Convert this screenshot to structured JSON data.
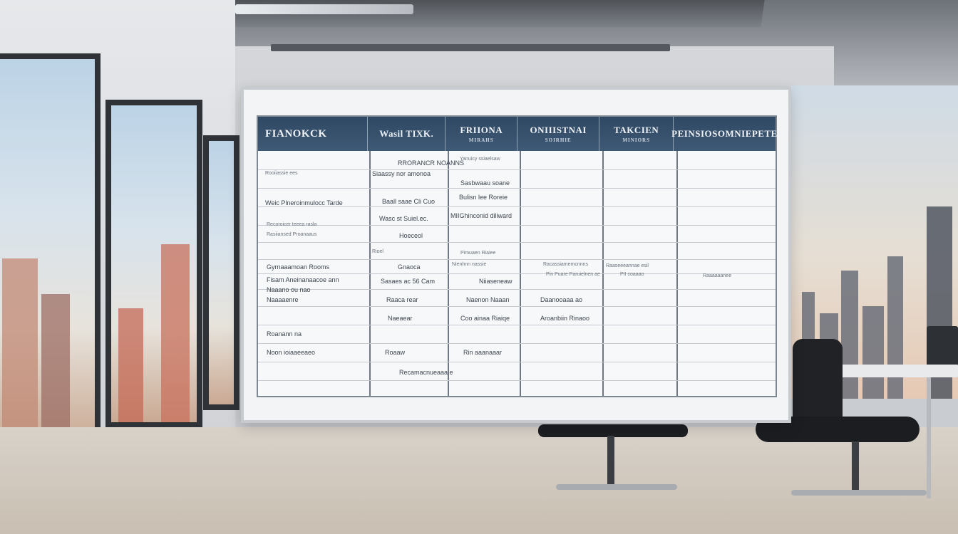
{
  "board": {
    "headers": [
      {
        "main": "FIANOKCK",
        "sub": ""
      },
      {
        "main": "Wasil TIXK.",
        "sub": ""
      },
      {
        "main": "FRIIONA",
        "sub": "MIRAHS"
      },
      {
        "main": "ONIIISTNAI",
        "sub": "SOIRHIE"
      },
      {
        "main": "TAKCIEN",
        "sub": "MINIORS"
      },
      {
        "main": "PEINSIOSOMNIEPETE",
        "sub": ""
      }
    ],
    "cells": [
      {
        "id": "c1",
        "text": "Rooiiassie ees"
      },
      {
        "id": "c2",
        "text": "RRORANCR NOANNS"
      },
      {
        "id": "c3",
        "text": "Siaassy nor amonoa"
      },
      {
        "id": "c4",
        "text": "Yanuicy ssiaelsaw"
      },
      {
        "id": "c5",
        "text": "Sasbwaau soane"
      },
      {
        "id": "c6",
        "text": "Weic Plneroinmulocc Tarde"
      },
      {
        "id": "c7",
        "text": "Baall saae Cli Cuo"
      },
      {
        "id": "c8",
        "text": "Bulisn lee Roreie"
      },
      {
        "id": "c9",
        "text": "Wasc st Suiel.ec."
      },
      {
        "id": "c10",
        "text": "MIIGhinconid diliward"
      },
      {
        "id": "c11",
        "text": "Recoroicer teeea rasla"
      },
      {
        "id": "c12",
        "text": "Hoeceol"
      },
      {
        "id": "c13",
        "text": "Rasiiansed Proanaaus"
      },
      {
        "id": "c14",
        "text": "Rioel"
      },
      {
        "id": "c15",
        "text": "Pimuaen Riaiee"
      },
      {
        "id": "c16",
        "text": "Gyrnaaamoan Rooms"
      },
      {
        "id": "c17",
        "text": "Gnaoca"
      },
      {
        "id": "c18",
        "text": "Nienhnn nassie"
      },
      {
        "id": "c19",
        "text": "Racassiamemcnnns"
      },
      {
        "id": "c20",
        "text": "Raaseeeannae esil"
      },
      {
        "id": "c21",
        "text": "Raaaaaanee"
      },
      {
        "id": "c22",
        "text": "Fisam Aneinanaacoe ann"
      },
      {
        "id": "c23",
        "text": "Sasaes ac 56 Cam"
      },
      {
        "id": "c24",
        "text": "Niiaseneaw"
      },
      {
        "id": "c25",
        "text": "Pin Puare Paruielnen ae"
      },
      {
        "id": "c26",
        "text": "PII coaaao"
      },
      {
        "id": "c27",
        "text": "Naaano ou nao"
      },
      {
        "id": "c28",
        "text": "Naaaaenre"
      },
      {
        "id": "c29",
        "text": "Raaca rear"
      },
      {
        "id": "c30",
        "text": "Naenon Naaan"
      },
      {
        "id": "c31",
        "text": "Daanooaaa ao"
      },
      {
        "id": "c32",
        "text": "Naeaear"
      },
      {
        "id": "c33",
        "text": "Coo ainaa Riaiqe"
      },
      {
        "id": "c34",
        "text": "Aroanbiin Rinaoo"
      },
      {
        "id": "c35",
        "text": "Roanann na"
      },
      {
        "id": "c36",
        "text": "Noon ioiaaeeaeo"
      },
      {
        "id": "c37",
        "text": "Roaaw"
      },
      {
        "id": "c38",
        "text": "Rin aaanaaar"
      },
      {
        "id": "c39",
        "text": "Recamacnueaaa e"
      }
    ]
  }
}
